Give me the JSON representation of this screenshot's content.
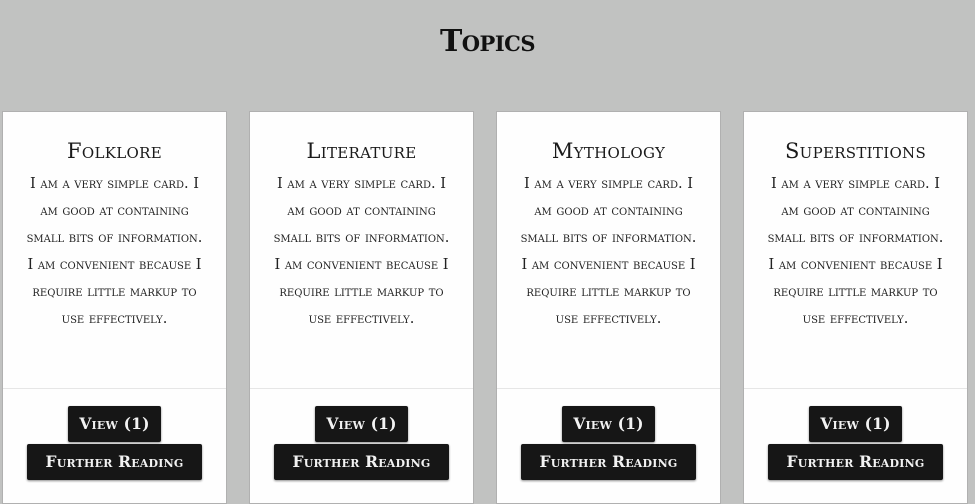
{
  "page": {
    "title": "Topics"
  },
  "cards": [
    {
      "title": "Folklore",
      "text": "I am a very simple card. I am good at containing small bits of information. I am convenient because I require little markup to use effectively.",
      "view_label": "View (1)",
      "further_label": "Further Reading"
    },
    {
      "title": "Literature",
      "text": "I am a very simple card. I am good at containing small bits of information. I am convenient because I require little markup to use effectively.",
      "view_label": "View (1)",
      "further_label": "Further Reading"
    },
    {
      "title": "Mythology",
      "text": "I am a very simple card. I am good at containing small bits of information. I am convenient because I require little markup to use effectively.",
      "view_label": "View (1)",
      "further_label": "Further Reading"
    },
    {
      "title": "Superstitions",
      "text": "I am a very simple card. I am good at containing small bits of information. I am convenient because I require little markup to use effectively.",
      "view_label": "View (1)",
      "further_label": "Further Reading"
    }
  ],
  "colors": {
    "background": "#c1c2c1",
    "card": "#fefefe",
    "button": "#161616",
    "button_text": "#f2f2f2"
  }
}
